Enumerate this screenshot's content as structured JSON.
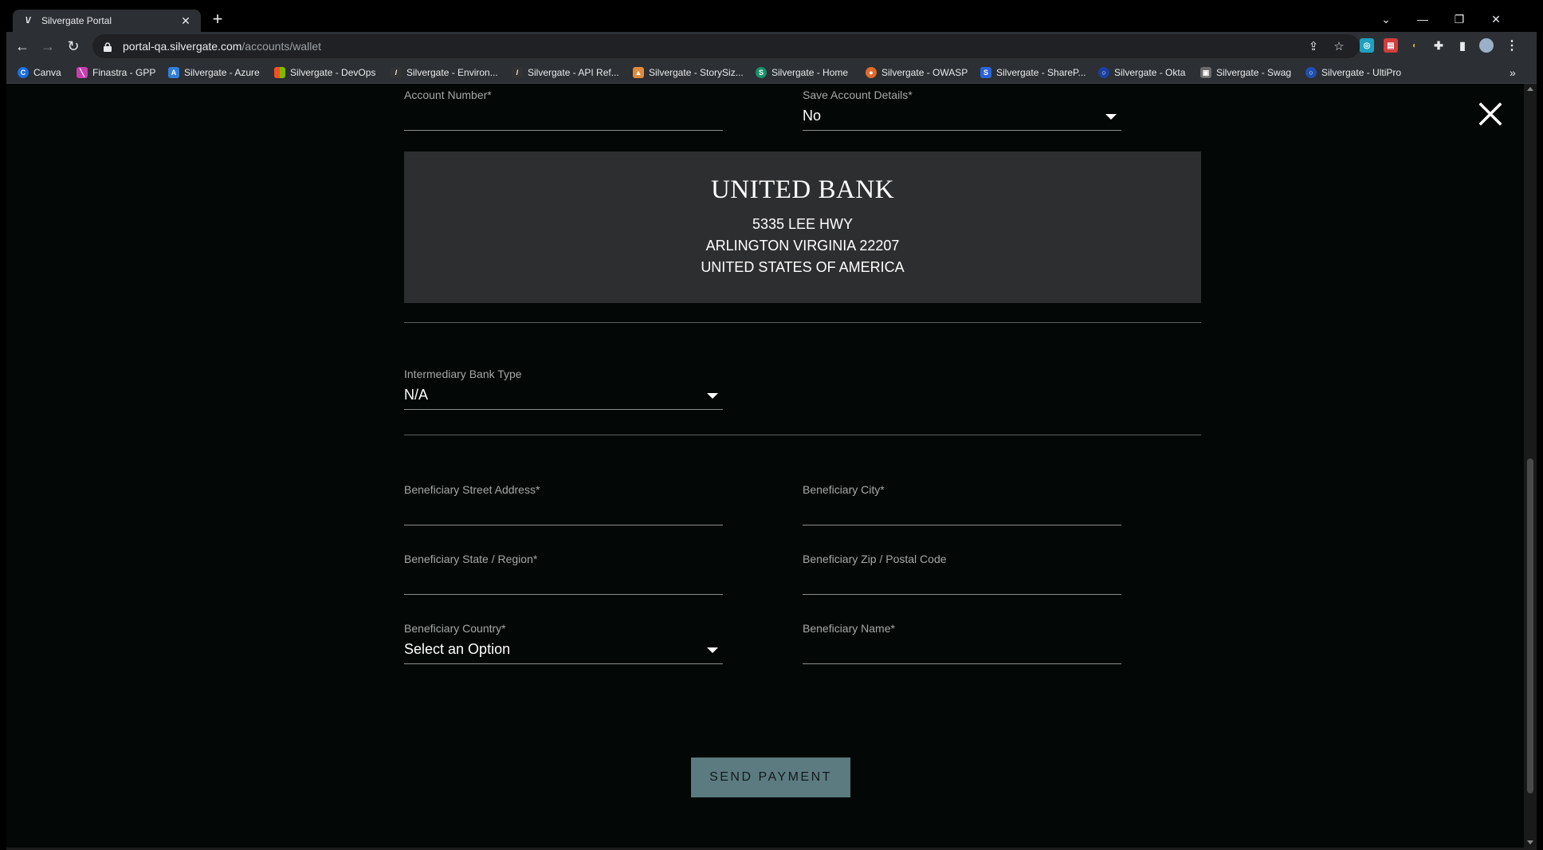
{
  "browser": {
    "tab_title": "Silvergate Portal",
    "url_host": "portal-qa.silvergate.com",
    "url_path": "/accounts/wallet",
    "bookmarks": [
      {
        "label": "Canva",
        "color": "#1a6fe0"
      },
      {
        "label": "Finastra - GPP",
        "color": "#c83db1"
      },
      {
        "label": "Silvergate - Azure",
        "color": "#2f7fd9"
      },
      {
        "label": "Silvergate - DevOps",
        "color": "#e74c3c"
      },
      {
        "label": "Silvergate - Environ...",
        "color": "#555555"
      },
      {
        "label": "Silvergate - API Ref...",
        "color": "#555555"
      },
      {
        "label": "Silvergate - StorySiz...",
        "color": "#e08a3c"
      },
      {
        "label": "Silvergate - Home",
        "color": "#1a8f6b"
      },
      {
        "label": "Silvergate - OWASP",
        "color": "#e06a2c"
      },
      {
        "label": "Silvergate - ShareP...",
        "color": "#2a63d8"
      },
      {
        "label": "Silvergate - Okta",
        "color": "#1b3fa0"
      },
      {
        "label": "Silvergate - Swag",
        "color": "#6b6b6b"
      },
      {
        "label": "Silvergate - UltiPro",
        "color": "#1f4fb0"
      }
    ]
  },
  "form": {
    "account_number": {
      "label": "Account Number*",
      "value": ""
    },
    "save_account_details": {
      "label": "Save Account Details*",
      "value": "No"
    },
    "bank": {
      "name": "UNITED BANK",
      "address_line1": "5335 LEE HWY",
      "address_line2": "ARLINGTON VIRGINIA 22207",
      "address_line3": "UNITED STATES OF AMERICA"
    },
    "intermediary_bank_type": {
      "label": "Intermediary Bank Type",
      "value": "N/A"
    },
    "beneficiary_street": {
      "label": "Beneficiary Street Address*",
      "value": ""
    },
    "beneficiary_city": {
      "label": "Beneficiary City*",
      "value": ""
    },
    "beneficiary_state": {
      "label": "Beneficiary State / Region*",
      "value": ""
    },
    "beneficiary_zip": {
      "label": "Beneficiary Zip / Postal Code",
      "value": ""
    },
    "beneficiary_country": {
      "label": "Beneficiary Country*",
      "value": "Select an Option"
    },
    "beneficiary_name": {
      "label": "Beneficiary Name*",
      "value": ""
    },
    "submit_label": "SEND PAYMENT"
  },
  "colors": {
    "page_bg": "#030807",
    "button_bg": "#5b7b80",
    "bank_box_bg": "#2d2e2f"
  }
}
